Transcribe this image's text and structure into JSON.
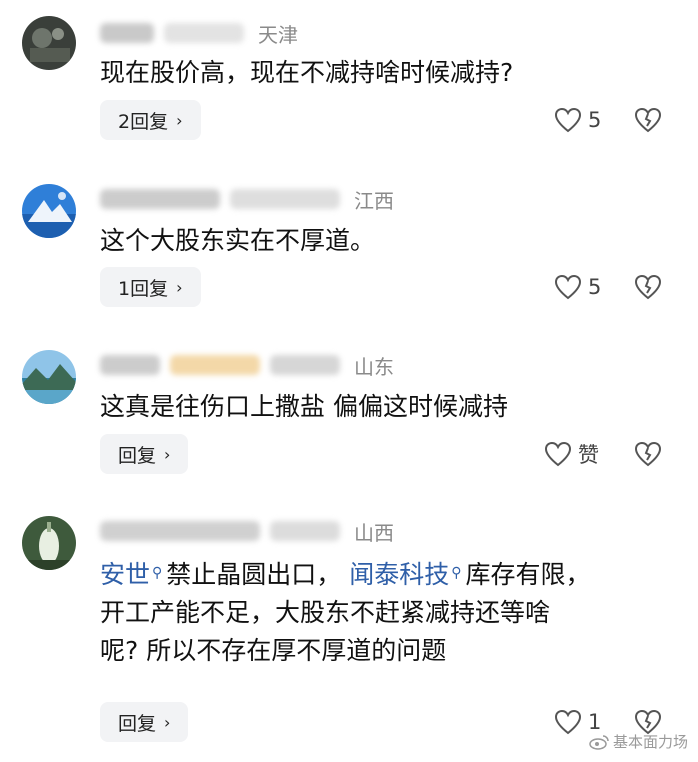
{
  "comments": [
    {
      "location": "天津",
      "text": "现在股价高，现在不减持啥时候减持?",
      "reply_label": "2回复",
      "like_count": "5"
    },
    {
      "location": "江西",
      "text": "这个大股东实在不厚道。",
      "reply_label": "1回复",
      "like_count": "5"
    },
    {
      "location": "山东",
      "text": "这真是往伤口上撒盐 偏偏这时候减持",
      "reply_label": "回复",
      "like_count": "赞"
    },
    {
      "location": "山西",
      "text_parts": {
        "link1": "安世",
        "seg1": "禁止晶圆出口，",
        "link2": "闻泰科技",
        "seg2": "库存有限，",
        "line2": "开工产能不足，大股东不赶紧减持还等啥",
        "line3": "呢? 所以不存在厚不厚道的问题"
      },
      "reply_label": "回复",
      "like_count": "1"
    }
  ],
  "watermark": "基本面力场",
  "colors": {
    "link": "#2f5fa8",
    "reply_bg": "#f2f3f5",
    "location": "#8a8a8a"
  },
  "icons": {
    "like": "heart-outline-icon",
    "dislike": "broken-heart-icon",
    "search_hint": "search-icon",
    "reply_arrow": "chevron-right-icon",
    "watermark_logo": "weibo-icon"
  }
}
